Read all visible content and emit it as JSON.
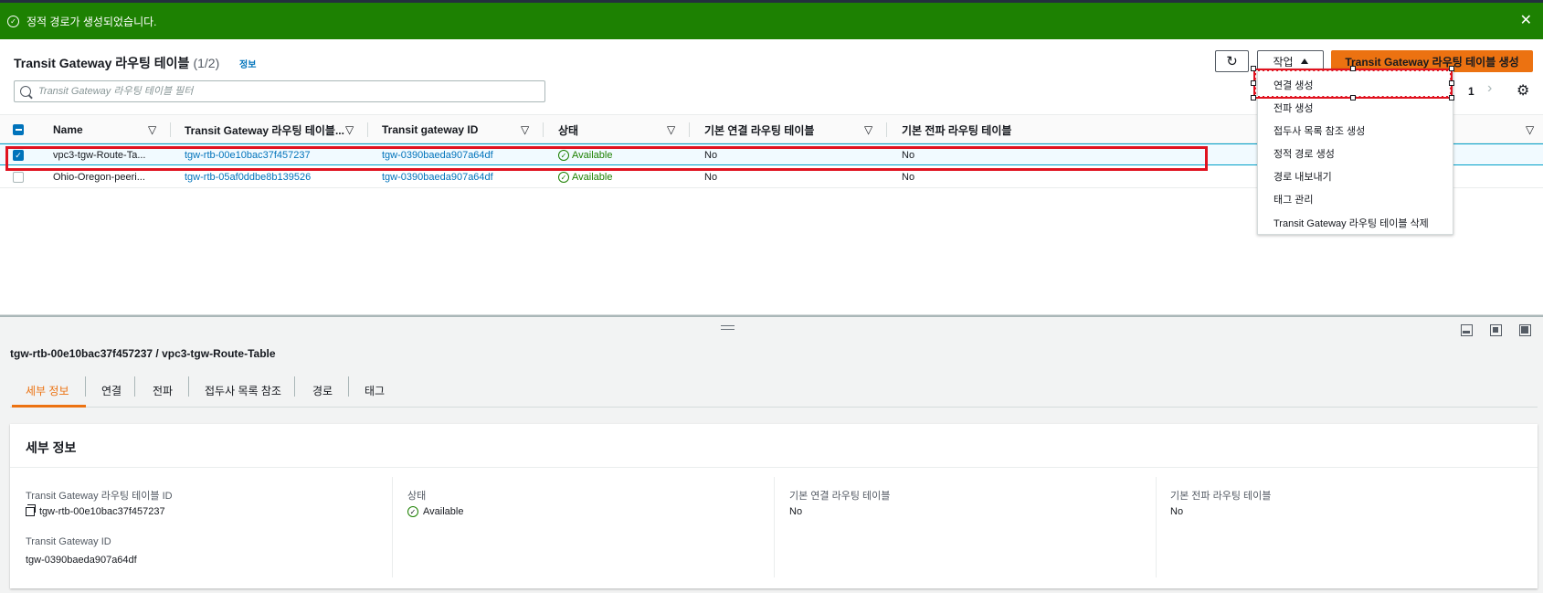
{
  "flash": {
    "message": "정적 경로가 생성되었습니다.",
    "close_icon": "✕"
  },
  "header": {
    "title": "Transit Gateway 라우팅 테이블",
    "count": "(1/2)",
    "info_link": "정보",
    "refresh_icon": "↻",
    "actions_label": "작업",
    "create_label": "Transit Gateway 라우팅 테이블 생성"
  },
  "search": {
    "placeholder": "Transit Gateway 라우팅 테이블 필터"
  },
  "pagination": {
    "page": "1",
    "next_icon": "›",
    "settings_icon": "⚙"
  },
  "table": {
    "columns": [
      "Name",
      "Transit Gateway 라우팅 테이블...",
      "Transit gateway ID",
      "상태",
      "기본 연결 라우팅 테이블",
      "기본 전파 라우팅 테이블"
    ],
    "rows": [
      {
        "selected": true,
        "name": "vpc3-tgw-Route-Ta...",
        "rtb_id": "tgw-rtb-00e10bac37f457237",
        "tgw_id": "tgw-0390baeda907a64df",
        "status": "Available",
        "assoc": "No",
        "prop": "No"
      },
      {
        "selected": false,
        "name": "Ohio-Oregon-peeri...",
        "rtb_id": "tgw-rtb-05af0ddbe8b139526",
        "tgw_id": "tgw-0390baeda907a64df",
        "status": "Available",
        "assoc": "No",
        "prop": "No"
      }
    ]
  },
  "actions_menu": {
    "items": [
      "연결 생성",
      "전파 생성",
      "접두사 목록 참조 생성",
      "정적 경로 생성",
      "경로 내보내기",
      "태그 관리",
      "Transit Gateway 라우팅 테이블 삭제"
    ]
  },
  "detail": {
    "title": "tgw-rtb-00e10bac37f457237 / vpc3-tgw-Route-Table",
    "tabs": [
      "세부 정보",
      "연결",
      "전파",
      "접두사 목록 참조",
      "경로",
      "태그"
    ],
    "card_title": "세부 정보",
    "fields": {
      "rtb_id_label": "Transit Gateway 라우팅 테이블 ID",
      "rtb_id_value": "tgw-rtb-00e10bac37f457237",
      "tgw_id_label": "Transit Gateway ID",
      "tgw_id_value": "tgw-0390baeda907a64df",
      "status_label": "상태",
      "status_value": "Available",
      "assoc_label": "기본 연결 라우팅 테이블",
      "assoc_value": "No",
      "prop_label": "기본 전파 라우팅 테이블",
      "prop_value": "No"
    }
  },
  "colors": {
    "success": "#1d8102",
    "primary_button": "#ec7211",
    "link": "#0073bb",
    "highlight": "#e0121f"
  }
}
